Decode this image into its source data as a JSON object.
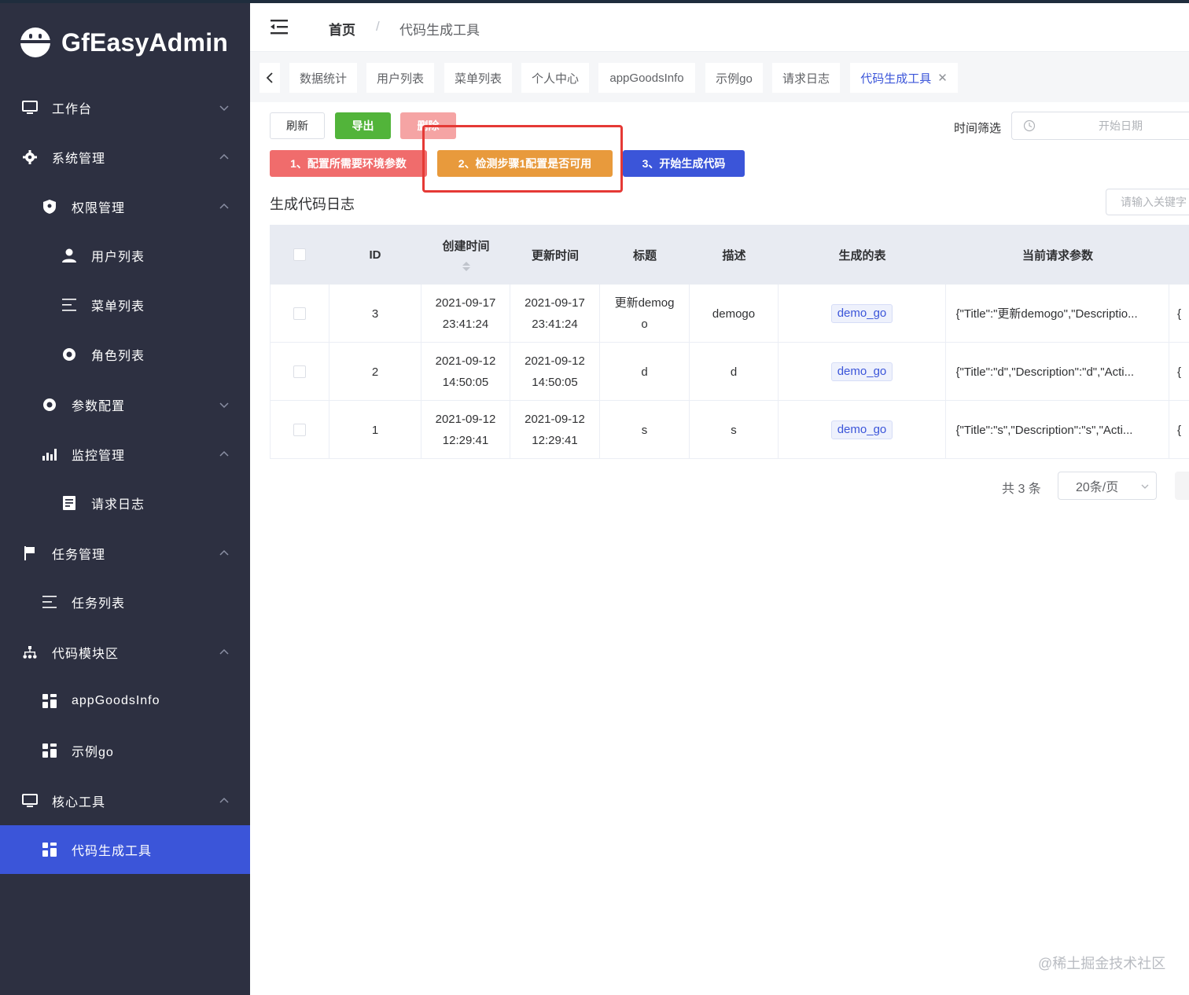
{
  "app": {
    "brand": "GfEasyAdmin"
  },
  "sidebar": {
    "items": [
      {
        "key": "workbench",
        "label": "工作台",
        "icon": "monitor-icon",
        "arrow": "down"
      },
      {
        "key": "system",
        "label": "系统管理",
        "icon": "gear-icon",
        "arrow": "up"
      },
      {
        "key": "permission",
        "label": "权限管理",
        "icon": "shield-icon",
        "arrow": "up"
      },
      {
        "key": "user-list",
        "label": "用户列表",
        "icon": "user-icon"
      },
      {
        "key": "menu-list",
        "label": "菜单列表",
        "icon": "list-icon"
      },
      {
        "key": "role-list",
        "label": "角色列表",
        "icon": "circle-dot-icon"
      },
      {
        "key": "param-config",
        "label": "参数配置",
        "icon": "circle-dot-icon",
        "arrow": "down"
      },
      {
        "key": "monitor",
        "label": "监控管理",
        "icon": "bar-chart-icon",
        "arrow": "up"
      },
      {
        "key": "request-log",
        "label": "请求日志",
        "icon": "document-icon"
      },
      {
        "key": "task",
        "label": "任务管理",
        "icon": "flag-icon",
        "arrow": "up"
      },
      {
        "key": "task-list",
        "label": "任务列表",
        "icon": "list-icon"
      },
      {
        "key": "code-module",
        "label": "代码模块区",
        "icon": "org-tree-icon",
        "arrow": "up"
      },
      {
        "key": "app-goods",
        "label": "appGoodsInfo",
        "icon": "grid-icon"
      },
      {
        "key": "example-go",
        "label": "示例go",
        "icon": "grid-icon"
      },
      {
        "key": "core-tools",
        "label": "核心工具",
        "icon": "monitor-icon",
        "arrow": "up"
      },
      {
        "key": "code-gen",
        "label": "代码生成工具",
        "icon": "grid-icon",
        "active": true
      }
    ]
  },
  "navbar": {
    "home": "首页",
    "separator": "/",
    "current": "代码生成工具"
  },
  "tags": [
    {
      "label": "数据统计"
    },
    {
      "label": "用户列表"
    },
    {
      "label": "菜单列表"
    },
    {
      "label": "个人中心"
    },
    {
      "label": "appGoodsInfo"
    },
    {
      "label": "示例go"
    },
    {
      "label": "请求日志"
    },
    {
      "label": "代码生成工具",
      "active": true
    }
  ],
  "toolbar": {
    "refresh": "刷新",
    "export": "导出",
    "delete": "删除",
    "step1": "1、配置所需要环境参数",
    "step2": "2、检测步骤1配置是否可用",
    "step3": "3、开始生成代码",
    "filter_label": "时间筛选",
    "date_placeholder": "开始日期"
  },
  "section": {
    "title": "生成代码日志",
    "search_placeholder": "请输入关键字"
  },
  "table": {
    "headers": {
      "id": "ID",
      "created": "创建时间",
      "updated": "更新时间",
      "title": "标题",
      "desc": "描述",
      "table": "生成的表",
      "params": "当前请求参数",
      "extra": ""
    },
    "rows": [
      {
        "id": "3",
        "created_date": "2021-09-17",
        "created_time": "23:41:24",
        "updated_date": "2021-09-17",
        "updated_time": "23:41:24",
        "title_line1": "更新demog",
        "title_line2": "o",
        "desc": "demogo",
        "table": "demo_go",
        "params": "{\"Title\":\"更新demogo\",\"Descriptio...",
        "extra": "{"
      },
      {
        "id": "2",
        "created_date": "2021-09-12",
        "created_time": "14:50:05",
        "updated_date": "2021-09-12",
        "updated_time": "14:50:05",
        "title_line1": "d",
        "title_line2": "",
        "desc": "d",
        "table": "demo_go",
        "params": "{\"Title\":\"d\",\"Description\":\"d\",\"Acti...",
        "extra": "{"
      },
      {
        "id": "1",
        "created_date": "2021-09-12",
        "created_time": "12:29:41",
        "updated_date": "2021-09-12",
        "updated_time": "12:29:41",
        "title_line1": "s",
        "title_line2": "",
        "desc": "s",
        "table": "demo_go",
        "params": "{\"Title\":\"s\",\"Description\":\"s\",\"Acti...",
        "extra": "{"
      }
    ]
  },
  "pagination": {
    "total": "共 3 条",
    "page_size": "20条/页"
  },
  "watermark": "@稀土掘金技术社区",
  "colors": {
    "sidebar_bg": "#2d3041",
    "accent": "#3b55d9",
    "success": "#52b43a",
    "danger": "#f06c6c",
    "warning": "#e89a3c",
    "highlight": "#e53935"
  }
}
